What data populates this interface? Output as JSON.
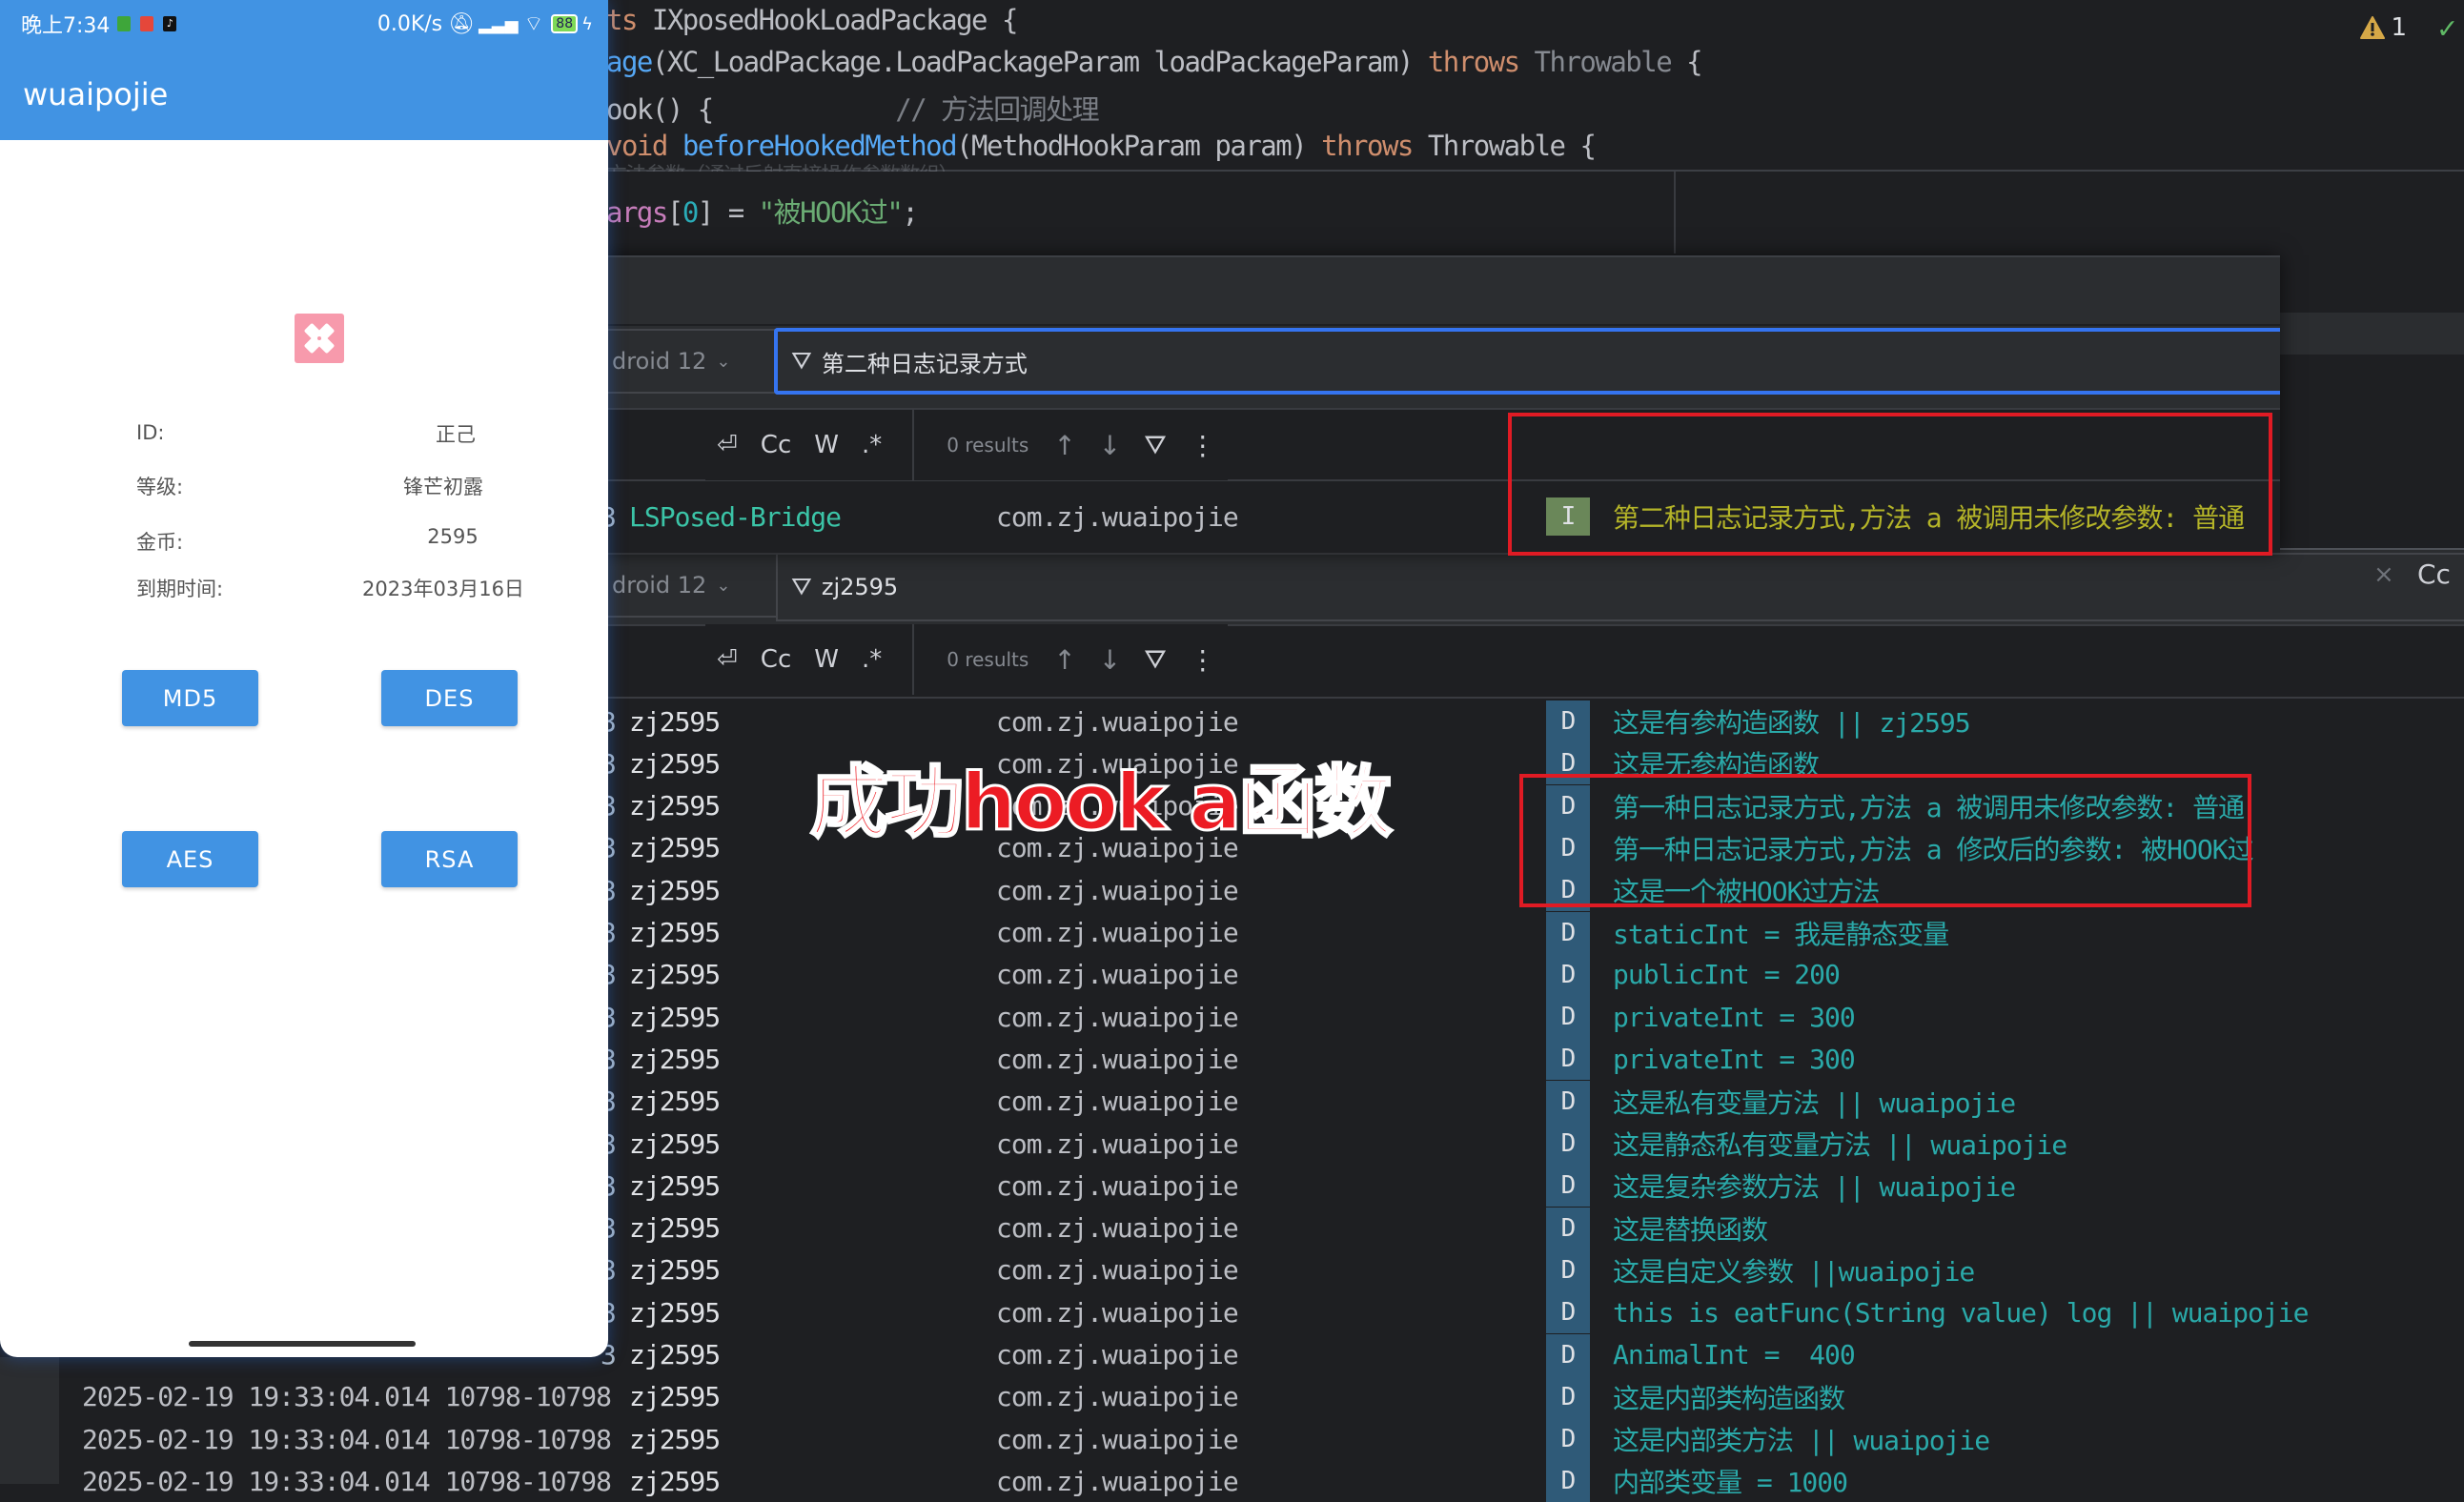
{
  "editor": {
    "lines": [
      {
        "parts": [
          "ts IXposedHookLoadPackage {"
        ]
      },
      {
        "p1": "age",
        "p2": "(XC_LoadPackage.LoadPackageParam loadPackageParam) ",
        "p3": "throws",
        "p4": " Throwable",
        "p5": " {"
      },
      {
        "p1": "ook() {",
        "p2": "            // 方法回调处理"
      },
      {
        "p1": "void ",
        "p2": "beforeHookedMethod",
        "p3": "(MethodHookParam param) ",
        "p4": "throws",
        "p5": " Throwable {"
      },
      {
        "p1": "方法参数（通过反射直接操作参数数组）"
      },
      {
        "p1": "args",
        "p2": "[",
        "p3": "0",
        "p4": "] = ",
        "p5": "\"被HOOK过\"",
        "p6": ";"
      }
    ],
    "line0": "ts IXposedHookLoadPackage {",
    "warnings_count": "1",
    "warning_icon": "warning-triangle-icon",
    "check_icon": "check-icon"
  },
  "logcat_top": {
    "device": "droid 12",
    "filter_value": "第二种日志记录方式",
    "toolbar": {
      "wrap": "⏎",
      "case": "Cc",
      "word": "W",
      "regex": ".*",
      "results": "0 results"
    },
    "rows": [
      {
        "prefix": "3",
        "tag": "LSPosed-Bridge",
        "package": "com.zj.wuaipojie",
        "level": "I",
        "message": "第二种日志记录方式,方法 a 被调用未修改参数: 普通"
      }
    ]
  },
  "logcat_bottom": {
    "device": "droid 12",
    "filter_value": "zj2595",
    "clear_label": "×",
    "case_label": "Cc",
    "toolbar": {
      "wrap": "⏎",
      "case": "Cc",
      "word": "W",
      "regex": ".*",
      "results": "0 results"
    },
    "rows": [
      {
        "prefix": "3",
        "tag": "zj2595",
        "package": "com.zj.wuaipojie",
        "level": "D",
        "message": "这是有参构造函数 || zj2595"
      },
      {
        "prefix": "3",
        "tag": "zj2595",
        "package": "com.zj.wuaipojie",
        "level": "D",
        "message": "这是无参构造函数"
      },
      {
        "prefix": "3",
        "tag": "zj2595",
        "package": "com.zj.wuaipojie",
        "level": "D",
        "message": "第一种日志记录方式,方法 a 被调用未修改参数: 普通"
      },
      {
        "prefix": "3",
        "tag": "zj2595",
        "package": "com.zj.wuaipojie",
        "level": "D",
        "message": "第一种日志记录方式,方法 a 修改后的参数: 被HOOK过"
      },
      {
        "prefix": "3",
        "tag": "zj2595",
        "package": "com.zj.wuaipojie",
        "level": "D",
        "message": "这是一个被HOOK过方法"
      },
      {
        "prefix": "3",
        "tag": "zj2595",
        "package": "com.zj.wuaipojie",
        "level": "D",
        "message": "staticInt = 我是静态变量"
      },
      {
        "prefix": "3",
        "tag": "zj2595",
        "package": "com.zj.wuaipojie",
        "level": "D",
        "message": "publicInt = 200"
      },
      {
        "prefix": "3",
        "tag": "zj2595",
        "package": "com.zj.wuaipojie",
        "level": "D",
        "message": "privateInt = 300"
      },
      {
        "prefix": "3",
        "tag": "zj2595",
        "package": "com.zj.wuaipojie",
        "level": "D",
        "message": "privateInt = 300"
      },
      {
        "prefix": "3",
        "tag": "zj2595",
        "package": "com.zj.wuaipojie",
        "level": "D",
        "message": "这是私有变量方法 || wuaipojie"
      },
      {
        "prefix": "3",
        "tag": "zj2595",
        "package": "com.zj.wuaipojie",
        "level": "D",
        "message": "这是静态私有变量方法 || wuaipojie"
      },
      {
        "prefix": "3",
        "tag": "zj2595",
        "package": "com.zj.wuaipojie",
        "level": "D",
        "message": "这是复杂参数方法 || wuaipojie"
      },
      {
        "prefix": "3",
        "tag": "zj2595",
        "package": "com.zj.wuaipojie",
        "level": "D",
        "message": "这是替换函数"
      },
      {
        "prefix": "3",
        "tag": "zj2595",
        "package": "com.zj.wuaipojie",
        "level": "D",
        "message": "这是自定义参数 ||wuaipojie"
      },
      {
        "prefix": "3",
        "tag": "zj2595",
        "package": "com.zj.wuaipojie",
        "level": "D",
        "message": "this is eatFunc(String value) log || wuaipojie"
      },
      {
        "prefix": "3",
        "tag": "zj2595",
        "package": "com.zj.wuaipojie",
        "level": "D",
        "message": "AnimalInt =  400"
      },
      {
        "prefix": "2025-02-19 19:33:04.014 10798-10798",
        "tag": "zj2595",
        "package": "com.zj.wuaipojie",
        "level": "D",
        "message": "这是内部类构造函数"
      },
      {
        "prefix": "2025-02-19 19:33:04.014 10798-10798",
        "tag": "zj2595",
        "package": "com.zj.wuaipojie",
        "level": "D",
        "message": "这是内部类方法 || wuaipojie"
      },
      {
        "prefix": "2025-02-19 19:33:04.014 10798-10798",
        "tag": "zj2595",
        "package": "com.zj.wuaipojie",
        "level": "D",
        "message": "内部类变量 = 1000"
      }
    ]
  },
  "annotation": {
    "text": "成功hook a函数",
    "color": "#ec1c24"
  },
  "phone": {
    "status": {
      "time": "晚上7:34",
      "speed": "0.0K/s",
      "battery": "88",
      "icons": [
        "android-icon",
        "app-icon",
        "tiktok-icon",
        "mute-icon",
        "signal-icon",
        "wifi-icon",
        "battery-icon",
        "charging-icon"
      ]
    },
    "app_title": "wuaipojie",
    "info": [
      {
        "label": "ID:",
        "value": "正己"
      },
      {
        "label": "等级:",
        "value": "锋芒初露"
      },
      {
        "label": "金币:",
        "value": "2595"
      },
      {
        "label": "到期时间:",
        "value": "2023年03月16日"
      }
    ],
    "buttons": [
      "MD5",
      "DES",
      "AES",
      "RSA"
    ],
    "accent": "#4193e3",
    "logo_color": "#f79aac"
  }
}
